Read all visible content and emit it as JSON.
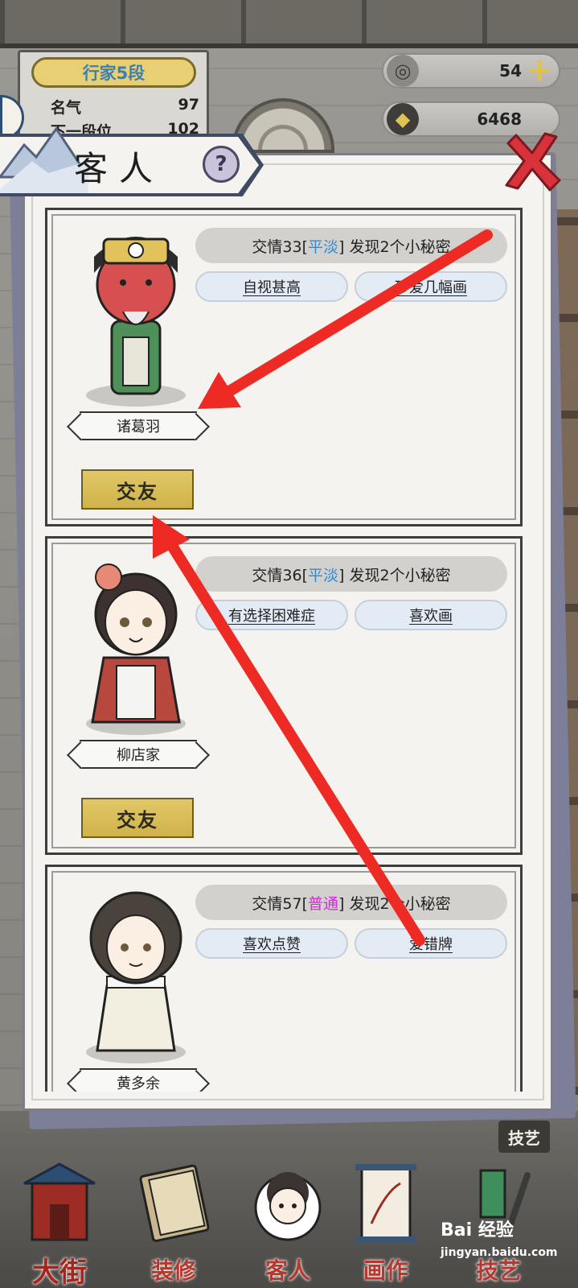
{
  "status": {
    "rank_title": "行家5段",
    "fame_label": "名气",
    "fame_value": "97",
    "next_rank_label": "下一段位",
    "next_rank_value": "102",
    "jade": "54",
    "coins": "6468"
  },
  "dialog": {
    "title": "客人",
    "help_symbol": "?"
  },
  "guests": [
    {
      "name": "诸葛羽",
      "relation_prefix": "交情33[",
      "relation_level": "平淡",
      "relation_suffix": "] 发现2个小秘密",
      "level_color": "#2f8ad8",
      "traits": [
        "自视甚高",
        "珍爱几幅画"
      ],
      "befriend_label": "交友"
    },
    {
      "name": "柳店家",
      "relation_prefix": "交情36[",
      "relation_level": "平淡",
      "relation_suffix": "] 发现2个小秘密",
      "level_color": "#2f8ad8",
      "traits": [
        "有选择困难症",
        "喜欢画"
      ],
      "befriend_label": "交友"
    },
    {
      "name": "黄多余",
      "relation_prefix": "交情57[",
      "relation_level": "普通",
      "relation_suffix": "] 发现2个小秘密",
      "level_color": "#d42bd6",
      "traits": [
        "喜欢点赞",
        "爱错牌"
      ]
    }
  ],
  "nav": {
    "skill_tag": "技艺",
    "items": [
      "大街",
      "装修",
      "客人",
      "画作",
      "技艺"
    ]
  },
  "watermark": {
    "logo": "Bai 经验",
    "url": "jingyan.baidu.com"
  },
  "colors": {
    "panel": "#f4f3ef",
    "gold_button": "#dcc35e",
    "level_calm": "#2f8ad8",
    "level_normal": "#d42bd6",
    "arrow": "#ee2a24"
  }
}
